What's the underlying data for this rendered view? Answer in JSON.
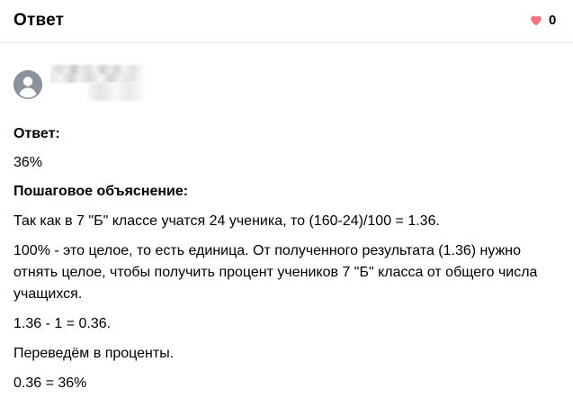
{
  "header": {
    "title": "Ответ",
    "like_count": "0",
    "like_color": "#f0737f"
  },
  "author": {
    "avatar_icon": "user-avatar-icon",
    "avatar_color": "#8c929b"
  },
  "answer": {
    "answer_label": "Ответ:",
    "answer_value": "36%",
    "explanation_label": "Пошаговое объяснение:",
    "paragraphs": [
      "Так как в 7 \"Б\" классе учатся 24 ученика, то (160-24)/100 = 1.36.",
      "100% - это целое, то есть единица. От полученного результата (1.36) нужно отнять целое, чтобы получить процент учеников 7 \"Б\" класса от общего числа учащихся.",
      "1.36 - 1 = 0.36.",
      "Переведём в проценты.",
      "0.36 = 36%"
    ]
  }
}
